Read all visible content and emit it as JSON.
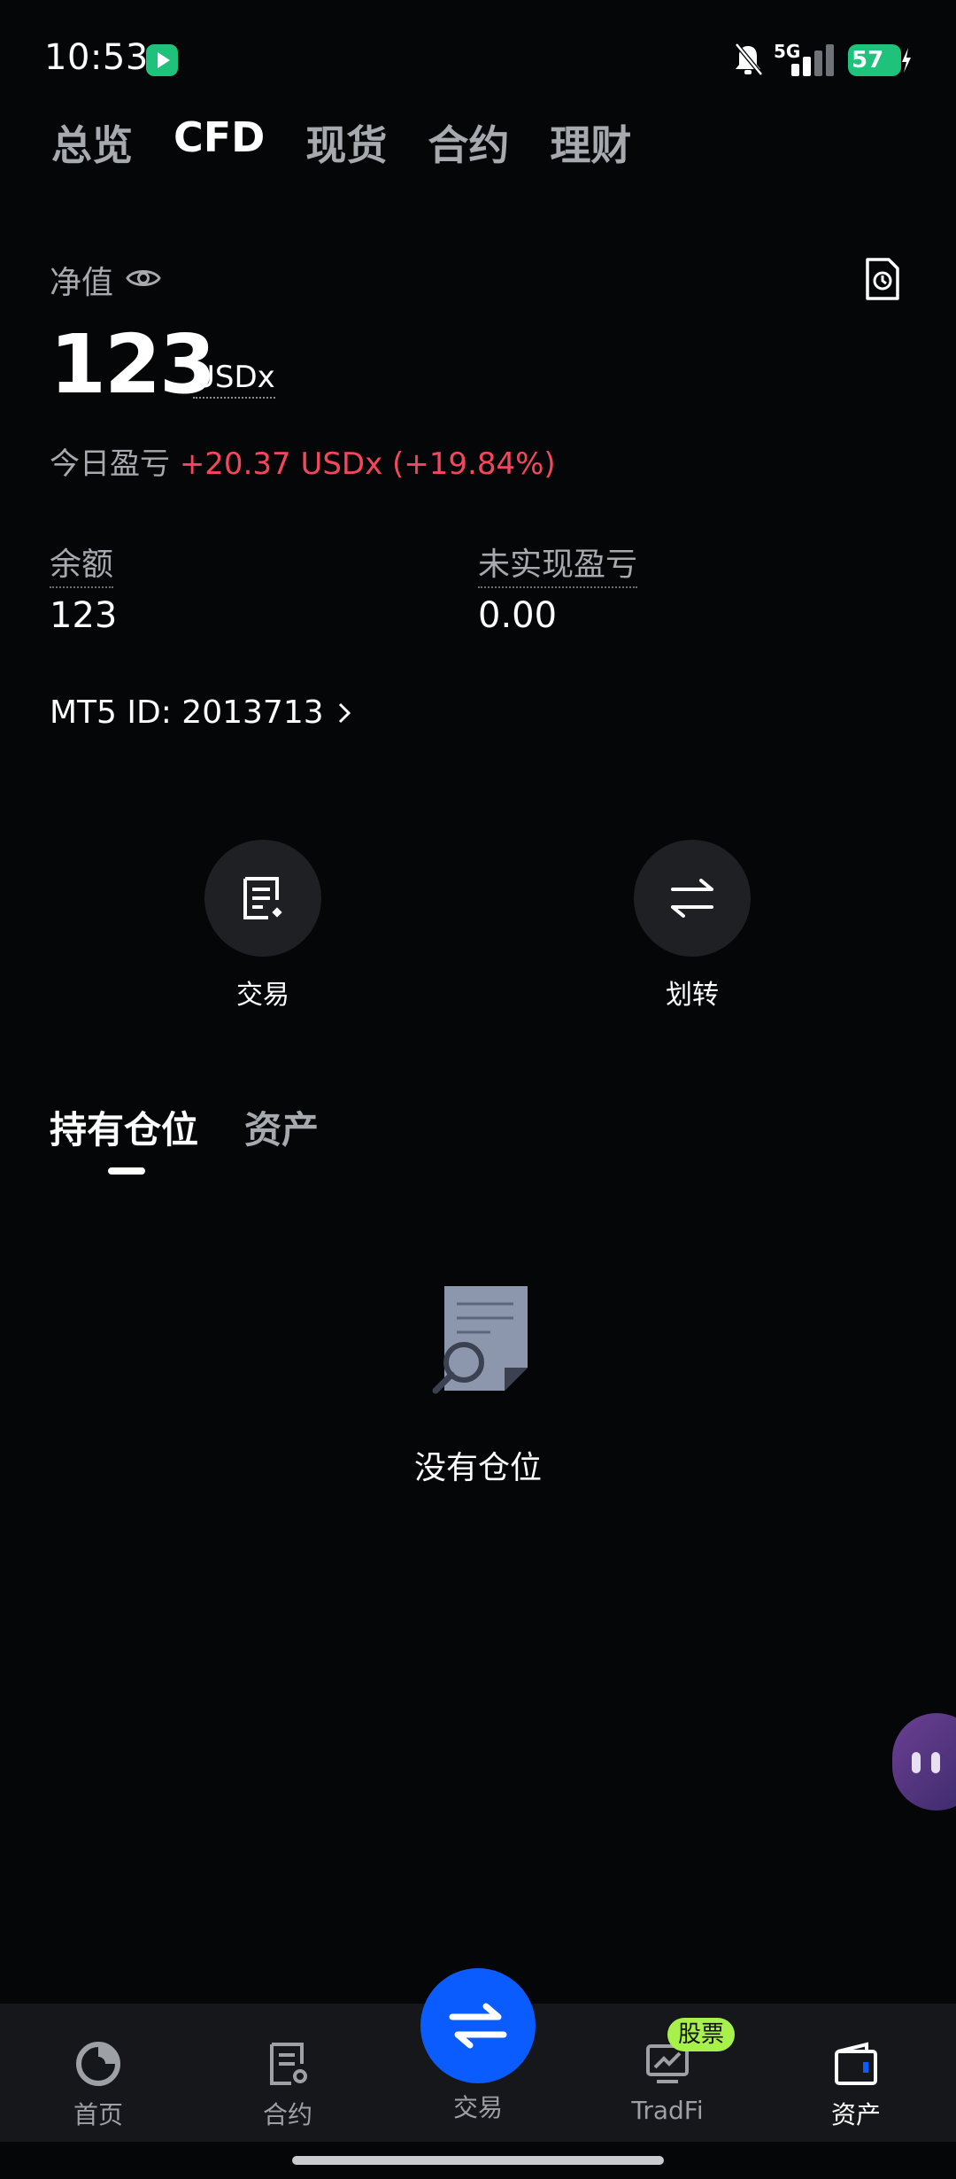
{
  "status": {
    "time": "10:53",
    "network": "5G",
    "battery": "57"
  },
  "top_tabs": [
    {
      "label": "总览",
      "active": false
    },
    {
      "label": "CFD",
      "active": true
    },
    {
      "label": "现货",
      "active": false
    },
    {
      "label": "合约",
      "active": false
    },
    {
      "label": "理财",
      "active": false
    }
  ],
  "account": {
    "net_value_label": "净值",
    "net_value": "123",
    "unit": "USDx",
    "today_pnl_label": "今日盈亏",
    "today_pnl_value": "+20.37 USDx (+19.84%)",
    "balance_label": "余额",
    "balance_value": "123",
    "unrealized_label": "未实现盈亏",
    "unrealized_value": "0.00",
    "mt5_id": "MT5 ID: 2013713"
  },
  "actions": {
    "trade_label": "交易",
    "transfer_label": "划转"
  },
  "position_tabs": {
    "holdings": "持有仓位",
    "assets": "资产"
  },
  "empty_state": {
    "text": "没有仓位"
  },
  "bottom_nav": {
    "home": "首页",
    "futures": "合约",
    "trade": "交易",
    "tradfi": "TradFi",
    "tradfi_badge": "股票",
    "assets": "资产"
  },
  "colors": {
    "background": "#050607",
    "accent_blue": "#0b5cff",
    "loss_red": "#f6465d",
    "badge_green": "#a8f04a"
  }
}
